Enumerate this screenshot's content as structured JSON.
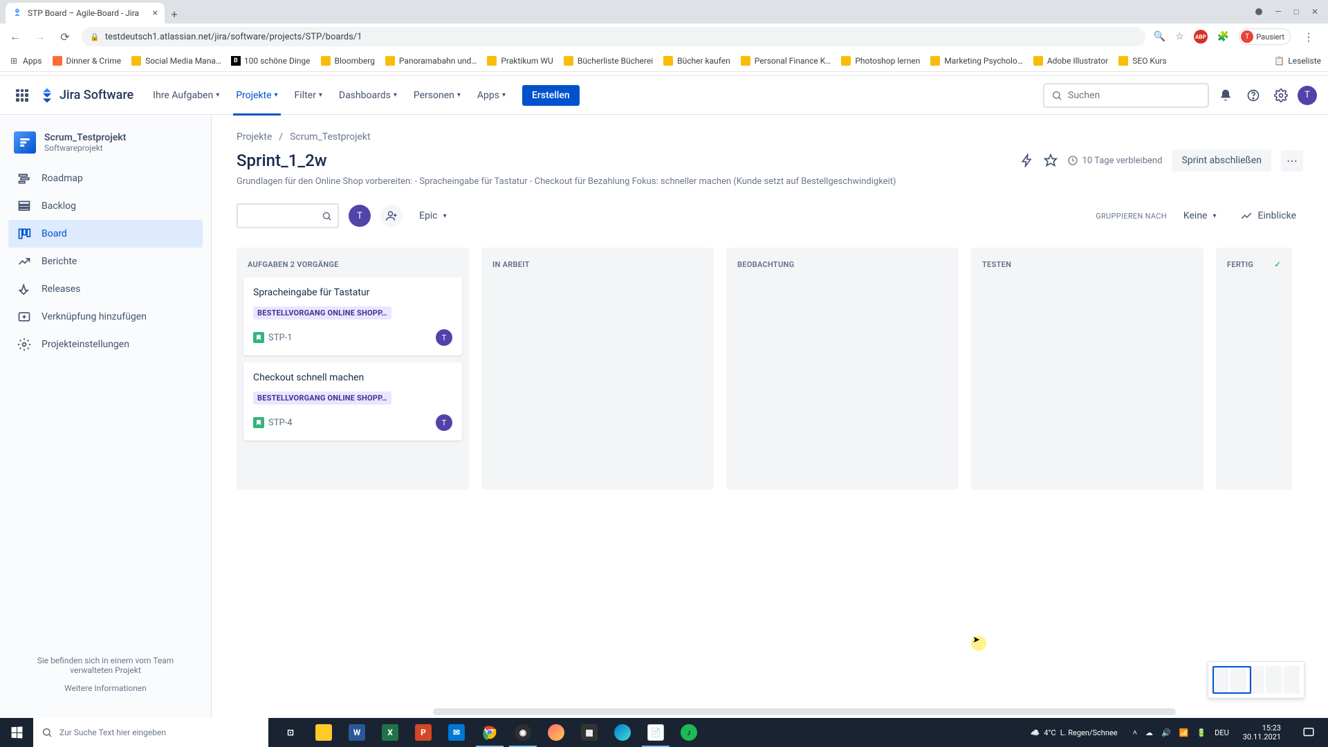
{
  "browser": {
    "tab_title": "STP Board – Agile-Board - Jira",
    "url": "testdeutsch1.atlassian.net/jira/software/projects/STP/boards/1",
    "profile_state": "Pausiert",
    "profile_initial": "T"
  },
  "bookmarks": {
    "apps": "Apps",
    "items": [
      "Dinner & Crime",
      "Social Media Mana…",
      "100 schöne Dinge",
      "Bloomberg",
      "Panoramabahn und…",
      "Praktikum WU",
      "Bücherliste Bücherei",
      "Bücher kaufen",
      "Personal Finance K…",
      "Photoshop lernen",
      "Marketing Psycholo…",
      "Adobe Illustrator",
      "SEO Kurs"
    ],
    "reading_list": "Leseliste"
  },
  "jira_nav": {
    "product": "Jira Software",
    "items": {
      "your_work": "Ihre Aufgaben",
      "projects": "Projekte",
      "filters": "Filter",
      "dashboards": "Dashboards",
      "people": "Personen",
      "apps": "Apps"
    },
    "create": "Erstellen",
    "search_placeholder": "Suchen"
  },
  "sidebar": {
    "project_name": "Scrum_Testprojekt",
    "project_type": "Softwareprojekt",
    "items": {
      "roadmap": "Roadmap",
      "backlog": "Backlog",
      "board": "Board",
      "reports": "Berichte",
      "releases": "Releases",
      "add_link": "Verknüpfung hinzufügen",
      "settings": "Projekteinstellungen"
    },
    "footer_text": "Sie befinden sich in einem vom Team verwalteten Projekt",
    "footer_link": "Weitere Informationen"
  },
  "breadcrumb": {
    "projects": "Projekte",
    "project": "Scrum_Testprojekt"
  },
  "page": {
    "title": "Sprint_1_2w",
    "remaining": "10 Tage verbleibend",
    "complete": "Sprint abschließen",
    "description": "Grundlagen für den Online Shop vorbereiten: - Spracheingabe für Tastatur - Checkout für Bezahlung Fokus: schneller machen (Kunde setzt auf Bestellgeschwindigkeit)"
  },
  "filters": {
    "epic": "Epic",
    "group_by_label": "GRUPPIEREN NACH",
    "group_by_value": "Keine",
    "insights": "Einblicke",
    "avatar_initial": "T"
  },
  "columns": {
    "todo": "AUFGABEN 2 VORGÄNGE",
    "in_progress": "IN ARBEIT",
    "watching": "BEOBACHTUNG",
    "testing": "TESTEN",
    "done": "FERTIG"
  },
  "cards": [
    {
      "title": "Spracheingabe für Tastatur",
      "epic": "BESTELLVORGANG ONLINE SHOPP…",
      "key": "STP-1",
      "assignee": "T"
    },
    {
      "title": "Checkout schnell machen",
      "epic": "BESTELLVORGANG ONLINE SHOPP…",
      "key": "STP-4",
      "assignee": "T"
    }
  ],
  "taskbar": {
    "search_placeholder": "Zur Suche Text hier eingeben",
    "weather_temp": "4°C",
    "weather_text": "L. Regen/Schnee",
    "lang": "DEU",
    "time": "15:23",
    "date": "30.11.2021"
  }
}
